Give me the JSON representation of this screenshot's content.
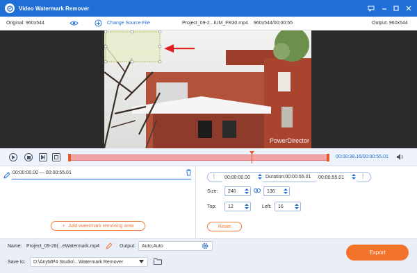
{
  "titlebar": {
    "title": "Video Watermark Remover"
  },
  "toolbar": {
    "original": "Original: 960x544",
    "change_source": "Change Source File",
    "filename": "Project_09-2...IUM_FR30.mp4",
    "file_info": "960x544/00:00:55",
    "output": "Output: 960x544"
  },
  "video": {
    "watermark_text": "PowerDirector"
  },
  "controls": {
    "time": "00:00:38.16/00:00:55.01"
  },
  "left": {
    "range": "00:00:00.00 — 00:00:55.01",
    "add_area": "Add watermark removing area"
  },
  "right": {
    "start": "00:00:00.00",
    "duration": "Duration:00:00:55.01",
    "end": "00:00:55.01",
    "size_label": "Size:",
    "width": "240",
    "height": "136",
    "top_label": "Top:",
    "top": "12",
    "left_label": "Left:",
    "left": "16",
    "reset": "Reset"
  },
  "bottom": {
    "name_label": "Name:",
    "name": "Project_09-28(...eWatermark.mp4",
    "output_label": "Output:",
    "output": "Auto;Auto",
    "save_label": "Save to:",
    "save_path": "D:\\AnyMP4 Studio\\...Watermark Remover",
    "export": "Export"
  },
  "colors": {
    "accent": "#1f6fd6",
    "orange": "#f4732a"
  }
}
